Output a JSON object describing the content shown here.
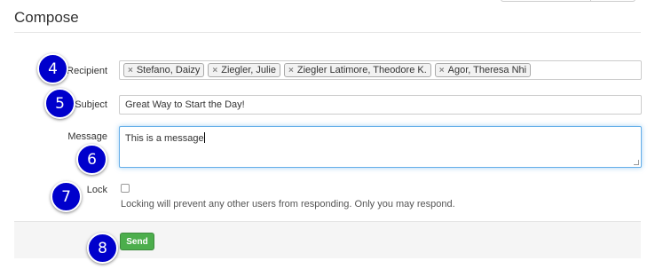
{
  "page": {
    "title": "Compose"
  },
  "form": {
    "recipient_label": "Recipient",
    "recipients": [
      "Stefano, Daizy",
      "Ziegler, Julie",
      "Ziegler Latimore, Theodore K.",
      "Agor, Theresa Nhi"
    ],
    "subject_label": "Subject",
    "subject_value": "Great Way to Start the Day!",
    "message_label": "Message",
    "message_value": "This is a message",
    "lock_label": "Lock",
    "lock_checked": false,
    "lock_help": "Locking will prevent any other users from responding. Only you may respond.",
    "send_label": "Send"
  },
  "annotations": {
    "step_4": "4",
    "step_5": "5",
    "step_6": "6",
    "step_7": "7",
    "step_8": "8",
    "badge_color": "#0000cc"
  },
  "colors": {
    "send_button": "#4cae4c",
    "focus_border": "#66afe9"
  },
  "icons": {
    "token_remove": "close-icon"
  }
}
